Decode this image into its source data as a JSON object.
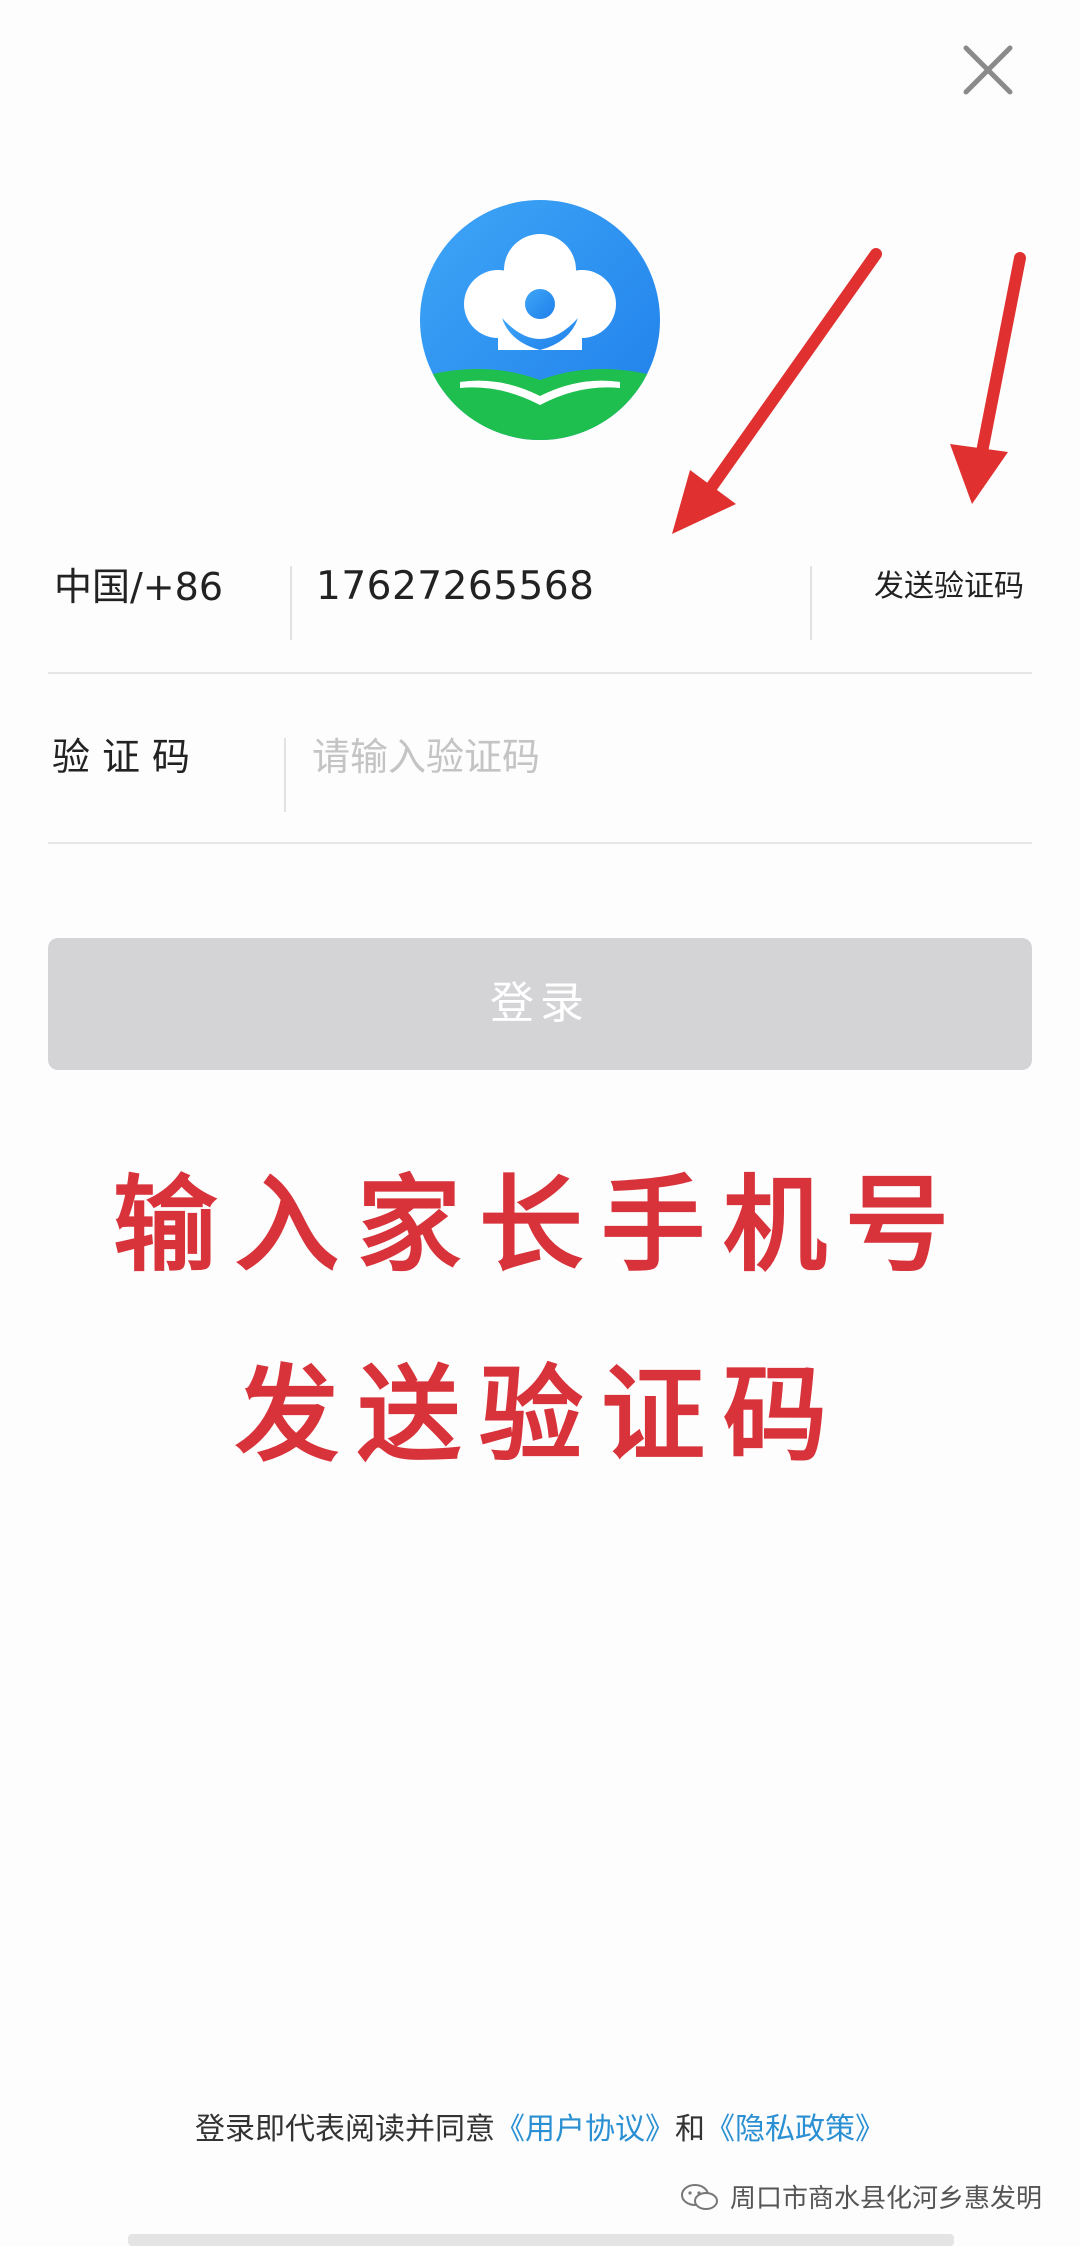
{
  "header": {
    "close_icon": "close-icon"
  },
  "logo": {
    "icon": "app-logo",
    "colors": {
      "blue": "#2b8ff0",
      "green": "#1fbf4f"
    }
  },
  "phone_row": {
    "country_code": "中国/+86",
    "phone_number": "17627265568",
    "send_code_label": "发送验证码"
  },
  "code_row": {
    "label": "验证码",
    "placeholder": "请输入验证码"
  },
  "login_button": {
    "label": "登录",
    "color": "#d4d3d6"
  },
  "annotation": {
    "line1": "输入家长手机号",
    "line2": "发送验证码",
    "color": "#d8323a"
  },
  "footer": {
    "prefix": "登录即代表阅读并同意",
    "user_agreement": "《用户协议》",
    "and": "和",
    "privacy_policy": "《隐私政策》",
    "link_color": "#2a8fd3"
  },
  "watermark": {
    "text": "周口市商水县化河乡惠发明"
  }
}
